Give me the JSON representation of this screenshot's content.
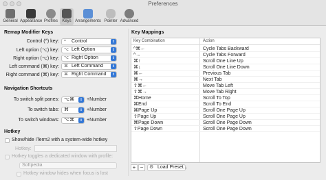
{
  "window": {
    "title": "Preferences"
  },
  "toolbar": {
    "items": [
      {
        "label": "General",
        "icon": "general-switch-icon",
        "color": "#6f6f6f"
      },
      {
        "label": "Appearance",
        "icon": "appearance-screen-icon",
        "color": "#3a3a3a"
      },
      {
        "label": "Profiles",
        "icon": "profiles-person-icon",
        "color": "#8a8a8a"
      },
      {
        "label": "Keys",
        "icon": "keys-keyboard-icon",
        "color": "#555555"
      },
      {
        "label": "Arrangements",
        "icon": "arrangements-icon",
        "color": "#5b8fd6"
      },
      {
        "label": "Pointer",
        "icon": "pointer-mouse-icon",
        "color": "#bdbdbd"
      },
      {
        "label": "Advanced",
        "icon": "advanced-gear-icon",
        "color": "#7d7d7d"
      }
    ],
    "active": "Keys"
  },
  "remap": {
    "title": "Remap Modifier Keys",
    "rows": [
      {
        "label": "Control (^) key:",
        "symbol": "^",
        "value": "Control"
      },
      {
        "label": "Left option (⌥) key:",
        "symbol": "⌥",
        "value": "Left Option"
      },
      {
        "label": "Right option (⌥) key:",
        "symbol": "⌥",
        "value": "Right Option"
      },
      {
        "label": "Left command (⌘) key:",
        "symbol": "⌘",
        "value": "Left Command"
      },
      {
        "label": "Right command (⌘) key:",
        "symbol": "⌘",
        "value": "Right Command"
      }
    ]
  },
  "nav": {
    "title": "Navigation Shortcuts",
    "rows": [
      {
        "label": "To switch split panes:",
        "value": "⌥⌘",
        "suffix": "+Number"
      },
      {
        "label": "To switch tabs:",
        "value": "⌘",
        "suffix": "+Number"
      },
      {
        "label": "To switch windows:",
        "value": "⌥⌘",
        "suffix": "+Number"
      }
    ]
  },
  "hotkey": {
    "title": "Hotkey",
    "show_hide": "Show/hide iTerm2 with a system-wide hotkey",
    "hotkey_label": "Hotkey:",
    "toggle_label": "Hotkey toggles a dedicated window with profile:",
    "profile_value": "Softpedia",
    "hide_label": "Hotkey window hides when focus is lost"
  },
  "mappings": {
    "title": "Key Mappings",
    "columns": [
      "Key Combination",
      "Action"
    ],
    "rows": [
      {
        "key": "^⌘←",
        "action": "Cycle Tabs Backward"
      },
      {
        "key": "^→",
        "action": "Cycle Tabs Forward"
      },
      {
        "key": "⌘↑",
        "action": "Scroll One Line Up"
      },
      {
        "key": "⌘↓",
        "action": "Scroll One Line Down"
      },
      {
        "key": "⌘←",
        "action": "Previous Tab"
      },
      {
        "key": "⌘→",
        "action": "Next Tab"
      },
      {
        "key": "⇧⌘←",
        "action": "Move Tab Left"
      },
      {
        "key": "⇧⌘→",
        "action": "Move Tab Right"
      },
      {
        "key": "⌘Home",
        "action": "Scroll To Top"
      },
      {
        "key": "⌘End",
        "action": "Scroll To End"
      },
      {
        "key": "⌘Page Up",
        "action": "Scroll One Page Up"
      },
      {
        "key": "⇧Page Up",
        "action": "Scroll One Page Up"
      },
      {
        "key": "⌘Page Down",
        "action": "Scroll One Page Down"
      },
      {
        "key": "⇧Page Down",
        "action": "Scroll One Page Down"
      }
    ],
    "add": "+",
    "remove": "−",
    "load_preset": "Load Preset..."
  }
}
